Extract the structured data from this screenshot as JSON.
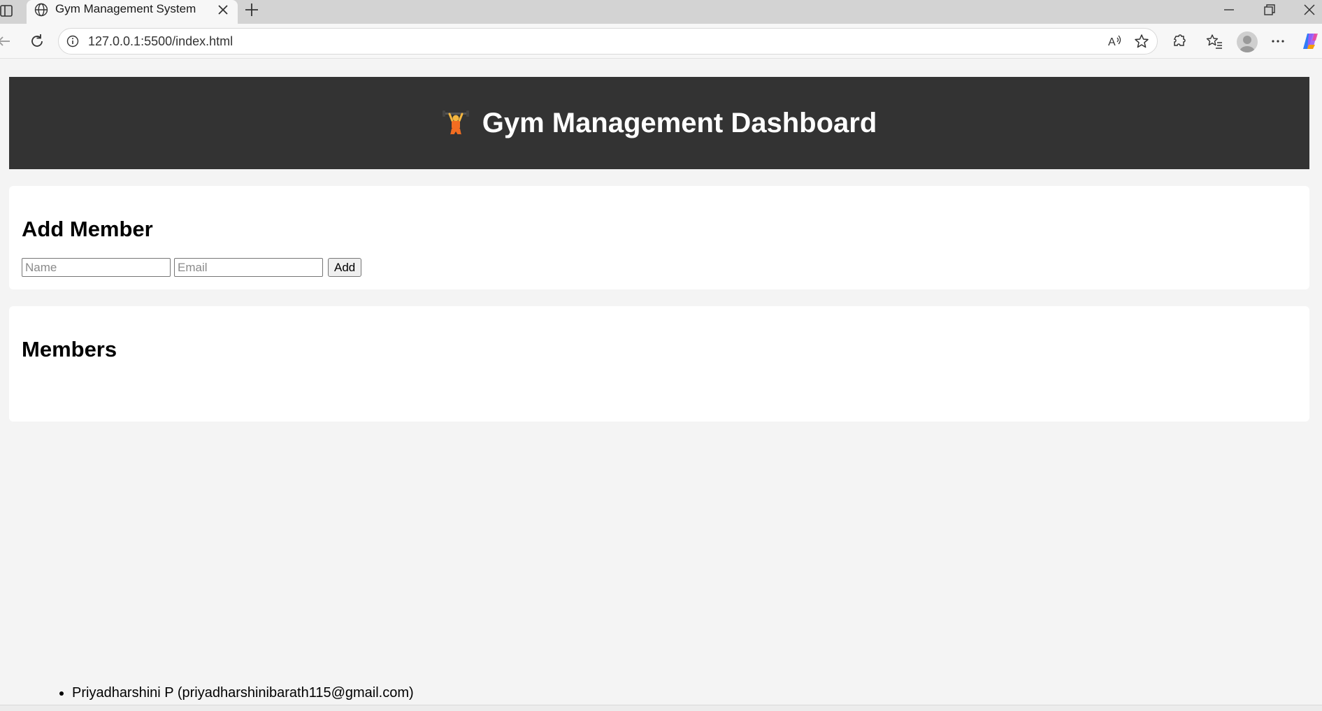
{
  "browser": {
    "tab_title": "Gym Management System",
    "url": "127.0.0.1:5500/index.html"
  },
  "icons": {
    "tab_favicon": "globe-icon",
    "tab_close": "close-icon",
    "new_tab": "plus-icon",
    "minimize": "minimize-icon",
    "restore": "restore-icon",
    "close_window": "close-icon",
    "back": "back-arrow-icon",
    "refresh": "refresh-icon",
    "site_info": "info-icon",
    "read_aloud": "read-aloud-icon",
    "favorite": "star-icon",
    "extensions": "puzzle-icon",
    "favorites": "favorites-icon",
    "profile": "avatar-icon",
    "menu": "more-icon",
    "copilot": "copilot-icon"
  },
  "header": {
    "emoji": "weightlifter-icon",
    "title": "Gym Management Dashboard"
  },
  "add_member": {
    "heading": "Add Member",
    "name_placeholder": "Name",
    "email_placeholder": "Email",
    "add_label": "Add"
  },
  "members": {
    "heading": "Members",
    "items": [
      "Priyadharshini P (priyadharshinibarath115@gmail.com)"
    ]
  }
}
